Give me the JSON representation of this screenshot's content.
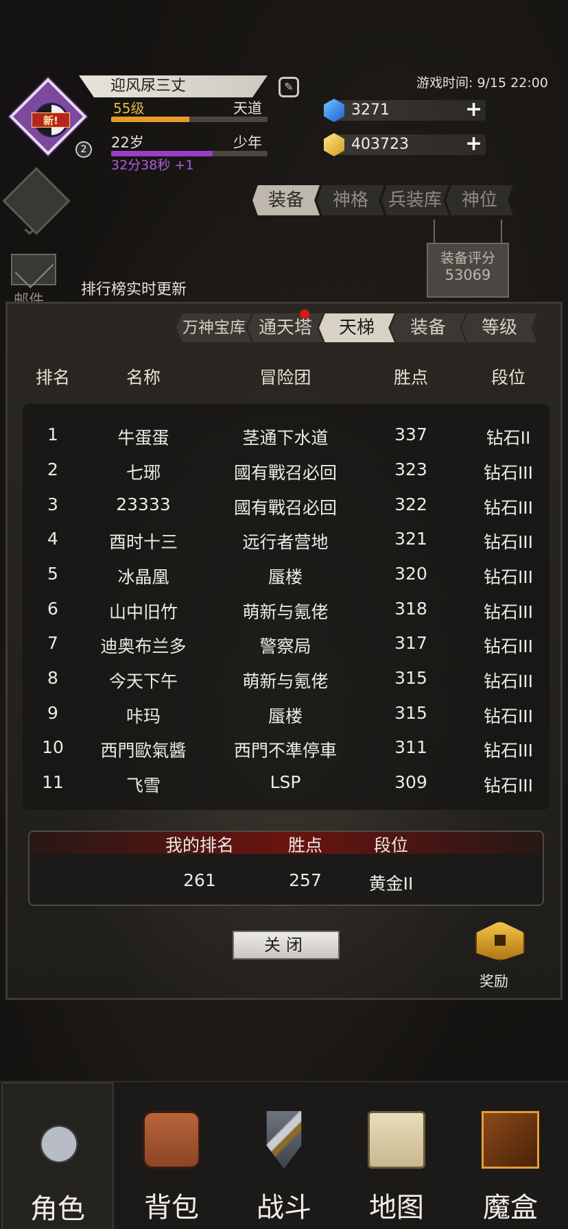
{
  "header": {
    "player_name": "迎风尿三丈",
    "level": "55级",
    "realm": "天道",
    "age": "22岁",
    "life_stage": "少年",
    "timer": "32分38秒 +1",
    "new_badge": "新!",
    "avatar_count": "2",
    "game_time": "游戏时间: 9/15 22:00",
    "gems": "3271",
    "gold": "403723",
    "xp_progress": 0.5,
    "age_progress": 0.65
  },
  "side": {
    "mail_label": "邮件",
    "live_note": "排行榜实时更新"
  },
  "top_tabs": [
    "装备",
    "神格",
    "兵装库",
    "神位"
  ],
  "equip_score": {
    "label": "装备评分",
    "value": "53069"
  },
  "leaderboard": {
    "tabs": [
      "万神宝库",
      "通天塔",
      "天梯",
      "装备",
      "等级"
    ],
    "columns": [
      "排名",
      "名称",
      "冒险团",
      "胜点",
      "段位"
    ],
    "rows": [
      [
        "1",
        "牛蛋蛋",
        "茎通下水道",
        "337",
        "钻石II"
      ],
      [
        "2",
        "七琊",
        "國有戰召必回",
        "323",
        "钻石III"
      ],
      [
        "3",
        "23333",
        "國有戰召必回",
        "322",
        "钻石III"
      ],
      [
        "4",
        "酉时十三",
        "远行者营地",
        "321",
        "钻石III"
      ],
      [
        "5",
        "冰晶凰",
        "蜃楼",
        "320",
        "钻石III"
      ],
      [
        "6",
        "山中旧竹",
        "萌新与氪佬",
        "318",
        "钻石III"
      ],
      [
        "7",
        "迪奥布兰多",
        "警察局",
        "317",
        "钻石III"
      ],
      [
        "8",
        "今天下午",
        "萌新与氪佬",
        "315",
        "钻石III"
      ],
      [
        "9",
        "咔玛",
        "蜃楼",
        "315",
        "钻石III"
      ],
      [
        "10",
        "西門歐氣醬",
        "西門不準停車",
        "311",
        "钻石III"
      ],
      [
        "11",
        "飞雪",
        "LSP",
        "309",
        "钻石III"
      ]
    ],
    "my": {
      "rank_label": "我的排名",
      "points_label": "胜点",
      "tier_label": "段位",
      "rank": "261",
      "points": "257",
      "tier": "黄金II"
    },
    "close_label": "关闭",
    "reward_label": "奖励"
  },
  "bottom_nav": [
    "角色",
    "背包",
    "战斗",
    "地图",
    "魔盒"
  ],
  "colors": {
    "accent_gold": "#e6b947",
    "xp_bar": "#e49a2f",
    "age_bar": "#9a3fc4",
    "my_rank_header": "#6a1410"
  }
}
